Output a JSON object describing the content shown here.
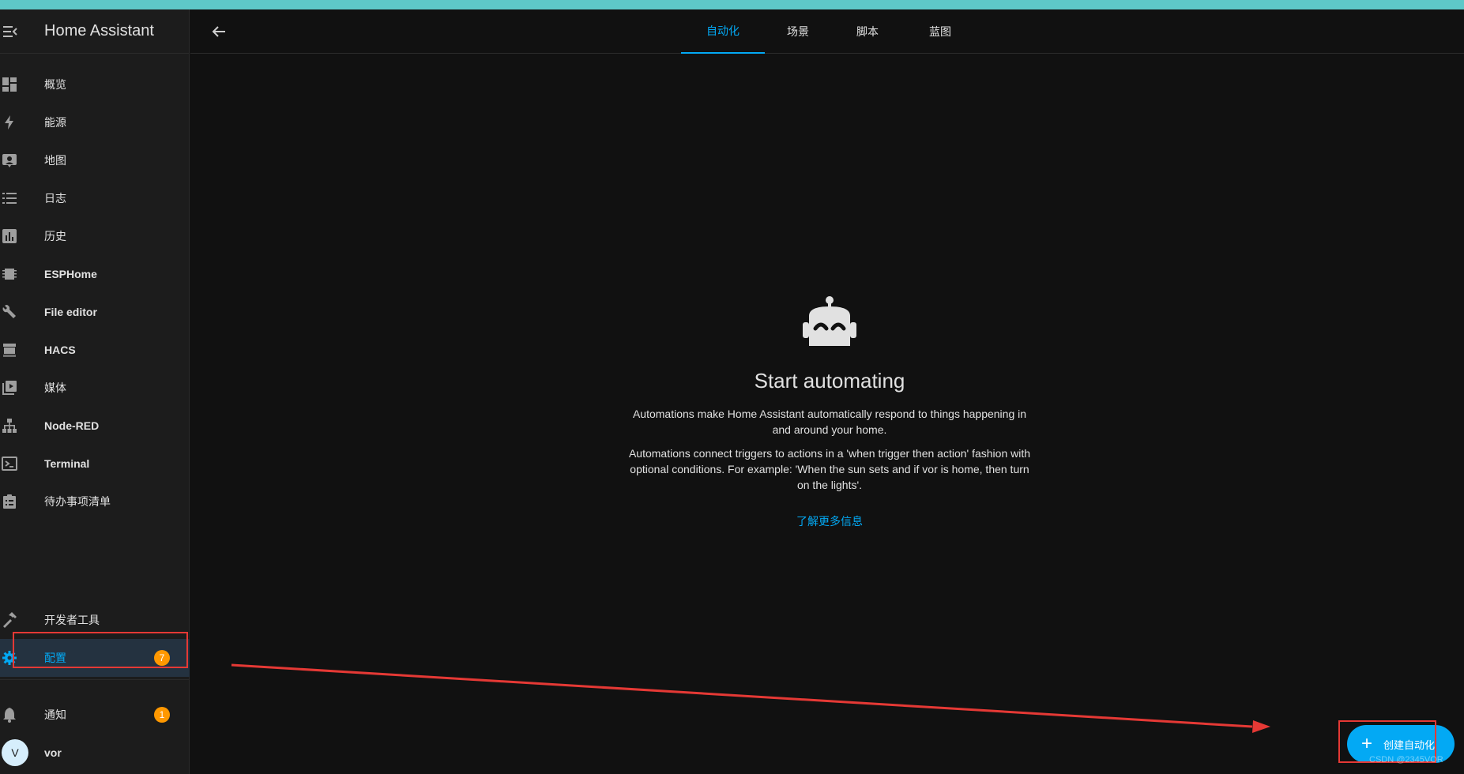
{
  "app": {
    "title": "Home Assistant"
  },
  "sidebar": {
    "items": [
      {
        "label": "概览",
        "icon": "dashboard-icon"
      },
      {
        "label": "能源",
        "icon": "lightning-icon"
      },
      {
        "label": "地图",
        "icon": "map-icon"
      },
      {
        "label": "日志",
        "icon": "list-icon"
      },
      {
        "label": "历史",
        "icon": "chart-icon"
      },
      {
        "label": "ESPHome",
        "icon": "chip-icon"
      },
      {
        "label": "File editor",
        "icon": "wrench-icon"
      },
      {
        "label": "HACS",
        "icon": "store-icon"
      },
      {
        "label": "媒体",
        "icon": "media-icon"
      },
      {
        "label": "Node-RED",
        "icon": "sitemap-icon"
      },
      {
        "label": "Terminal",
        "icon": "terminal-icon"
      },
      {
        "label": "待办事项清单",
        "icon": "clipboard-icon"
      }
    ],
    "dev_tools": {
      "label": "开发者工具",
      "icon": "hammer-icon"
    },
    "config": {
      "label": "配置",
      "icon": "gear-icon",
      "badge": "7"
    },
    "notifications": {
      "label": "通知",
      "icon": "bell-icon",
      "badge": "1"
    },
    "user": {
      "initial": "V",
      "name": "vor"
    }
  },
  "tabs": [
    {
      "label": "自动化",
      "active": true
    },
    {
      "label": "场景"
    },
    {
      "label": "脚本"
    },
    {
      "label": "蓝图"
    }
  ],
  "empty_state": {
    "icon": "robot-icon",
    "title": "Start automating",
    "text1": "Automations make Home Assistant automatically respond to things happening in and around your home.",
    "text2": "Automations connect triggers to actions in a 'when trigger then action' fashion with optional conditions. For example: 'When the sun sets and if vor is home, then turn on the lights'.",
    "learn_more": "了解更多信息"
  },
  "fab": {
    "label": "创建自动化",
    "icon": "plus-icon"
  },
  "watermark": "CSDN @2345VOR",
  "colors": {
    "accent": "#03a9f4",
    "badge": "#ff9800",
    "annotation": "#e53935",
    "background": "#111111",
    "sidebar": "#1c1c1c"
  }
}
